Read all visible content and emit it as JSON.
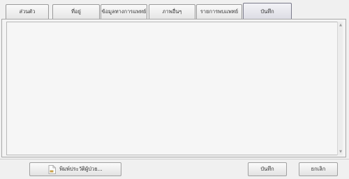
{
  "tabs": [
    {
      "label": "ส่วนตัว"
    },
    {
      "label": "ที่อยู่"
    },
    {
      "label": "ข้อมูลทางการแพทย์"
    },
    {
      "label": "ภาพอื่นๆ"
    },
    {
      "label": "รายการพบแพทย์"
    },
    {
      "label": "บันทึก"
    }
  ],
  "active_tab": "บันทึก",
  "notes_value": "",
  "footer": {
    "print_label": "พิมพ์ประวัติผู้ป่วย...",
    "save_label": "บันทึก",
    "cancel_label": "ยกเลิก"
  },
  "icons": {
    "print": "document-icon",
    "scroll_up": "scroll-up-arrow-icon",
    "scroll_down": "scroll-down-arrow-icon"
  }
}
